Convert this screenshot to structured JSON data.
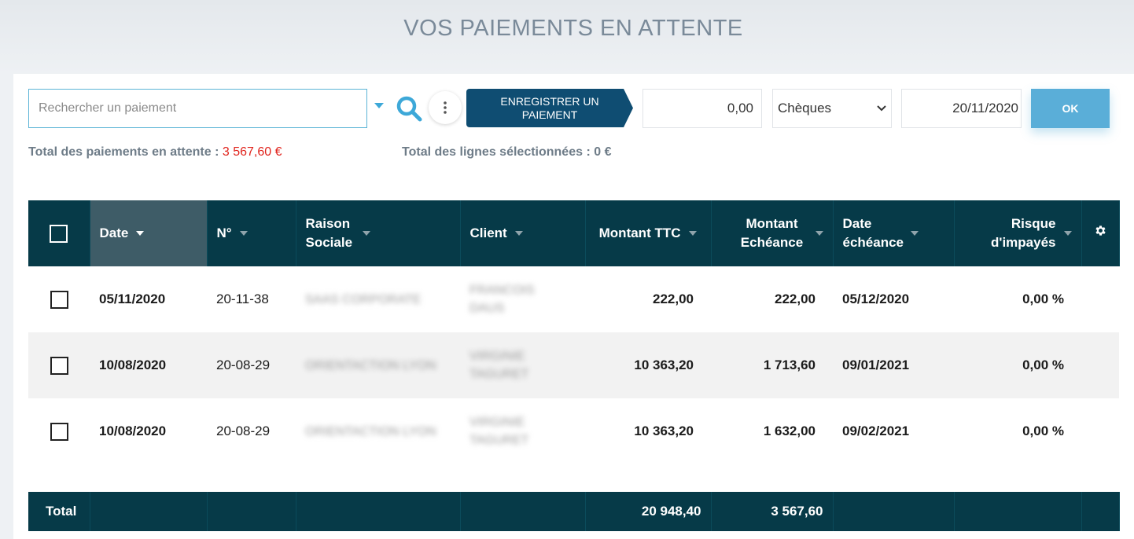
{
  "page_title": "VOS PAIEMENTS EN ATTENTE",
  "toolbar": {
    "search_placeholder": "Rechercher un paiement",
    "register_label": "ENREGISTRER UN PAIEMENT",
    "amount_value": "0,00",
    "payment_method": "Chèques",
    "date_value": "20/11/2020",
    "ok_label": "OK"
  },
  "totals": {
    "pending_label": "Total des paiements en attente :",
    "pending_value": "3 567,60 €",
    "selected_label": "Total des lignes sélectionnées :",
    "selected_value": "0 €"
  },
  "table": {
    "headers": {
      "date": "Date",
      "number": "N°",
      "company": "Raison Sociale",
      "client": "Client",
      "amount_ttc": "Montant TTC",
      "amount_due": "Montant Echéance",
      "due_date": "Date échéance",
      "risk": "Risque d'impayés"
    },
    "rows": [
      {
        "date": "05/11/2020",
        "number": "20-11-38",
        "company": "SAAS CORPORATE",
        "client": "FRANCOIS DAUS",
        "amount_ttc": "222,00",
        "amount_due": "222,00",
        "due_date": "05/12/2020",
        "risk": "0,00 %"
      },
      {
        "date": "10/08/2020",
        "number": "20-08-29",
        "company": "ORIENTACTION LYON",
        "client": "VIRGINIE TAGURET",
        "amount_ttc": "10 363,20",
        "amount_due": "1 713,60",
        "due_date": "09/01/2021",
        "risk": "0,00 %"
      },
      {
        "date": "10/08/2020",
        "number": "20-08-29",
        "company": "ORIENTACTION LYON",
        "client": "VIRGINIE TAGURET",
        "amount_ttc": "10 363,20",
        "amount_due": "1 632,00",
        "due_date": "09/02/2021",
        "risk": "0,00 %"
      }
    ],
    "footer": {
      "label": "Total",
      "amount_ttc": "20 948,40",
      "amount_due": "3 567,60"
    }
  },
  "colors": {
    "header_bg": "#063a48",
    "active_header_bg": "#3e5c67",
    "register_button": "#0f4d72",
    "ok_button": "#5aaed8",
    "pending_total": "#e0221b"
  },
  "icons": {
    "search": "search-icon",
    "more": "vertical-dots-icon",
    "caret": "chevron-down-icon",
    "settings": "gear-icon"
  }
}
